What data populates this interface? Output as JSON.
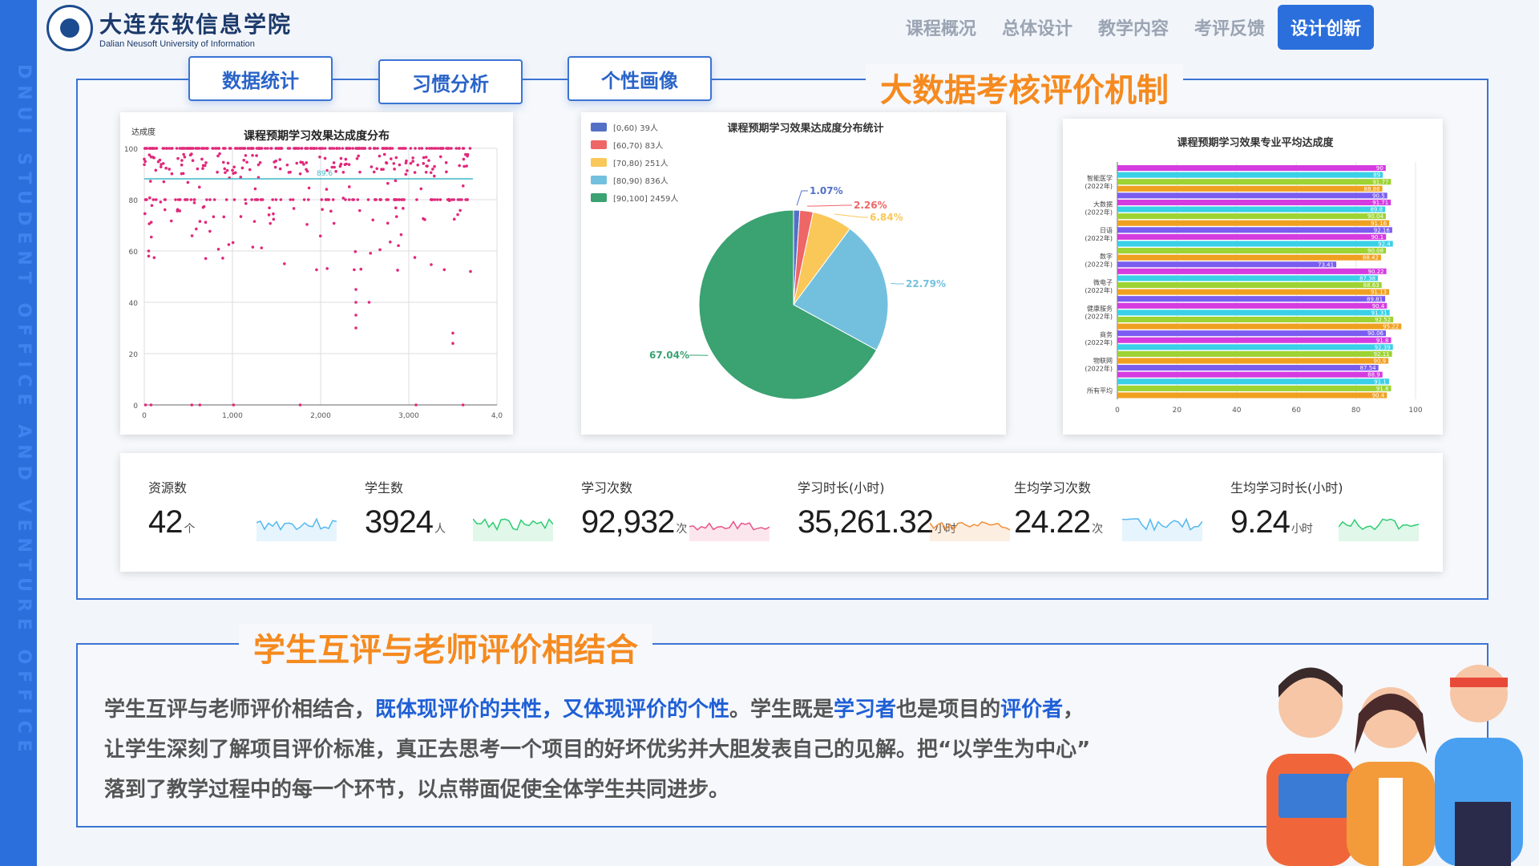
{
  "brand": {
    "cn": "大连东软信息学院",
    "en": "Dalian Neusoft University of Information",
    "side_text": "DNUI STUDENT OFFICE AND VENTURE OFFICE"
  },
  "nav": {
    "items": [
      "课程概况",
      "总体设计",
      "教学内容",
      "考评反馈",
      "设计创新"
    ],
    "active": "设计创新"
  },
  "section1": {
    "title": "大数据考核评价机制",
    "tabs": [
      "数据统计",
      "习惯分析",
      "个性画像"
    ]
  },
  "colors": {
    "primary": "#2a6fdc",
    "accent": "#f58a1f",
    "highlight": "#1f5fd6"
  },
  "chart_data": [
    {
      "type": "scatter",
      "title": "课程预期学习效果达成度分布",
      "ylabel": "达成度",
      "xlim": [
        0,
        4000
      ],
      "ylim": [
        0,
        100
      ],
      "x_ticks": [
        "0",
        "1,000",
        "2,000",
        "3,000",
        "4,0"
      ],
      "y_ticks": [
        "0",
        "20",
        "40",
        "60",
        "80",
        "100"
      ],
      "reference_line": {
        "label": "89.6",
        "value": 90
      },
      "series_color": "#e0287a",
      "grid": true
    },
    {
      "type": "pie",
      "title": "课程预期学习效果达成度分布统计",
      "legend_position": "top-left",
      "legend": [
        "[0,60) 39人",
        "[60,70) 83人",
        "[70,80) 251人",
        "[80,90) 836人",
        "[90,100] 2459人"
      ],
      "slices": [
        {
          "label": "[0,60)",
          "count": 39,
          "percent_label": "1.07%",
          "color": "#5470c6"
        },
        {
          "label": "[60,70)",
          "count": 83,
          "percent_label": "2.26%",
          "color": "#ee6666"
        },
        {
          "label": "[70,80)",
          "count": 251,
          "percent_label": "6.84%",
          "color": "#fac858"
        },
        {
          "label": "[80,90)",
          "count": 836,
          "percent_label": "22.79%",
          "color": "#73c0de"
        },
        {
          "label": "[90,100]",
          "count": 2459,
          "percent_label": "67.04%",
          "color": "#3ba272"
        }
      ]
    },
    {
      "type": "bar",
      "orientation": "horizontal",
      "title": "课程预期学习效果专业平均达成度",
      "xlim": [
        0,
        100
      ],
      "x_ticks": [
        "0",
        "20",
        "40",
        "60",
        "80",
        "100"
      ],
      "categories": [
        "智能医学\n(2022年)",
        "大数据\n(2022年)",
        "日语\n(2022年)",
        "数字\n(2022年)",
        "微电子\n(2022年)",
        "健康服务\n(2022年)",
        "商务\n(2022年)",
        "物联网\n(2022年)",
        "所有平均"
      ],
      "bar_colors": [
        "#d43ce0",
        "#3ad0e8",
        "#9dd332",
        "#f0a020",
        "#7b5cf0"
      ],
      "values": [
        90,
        89,
        91.77,
        88.86,
        90.5,
        91.71,
        89.8,
        90.04,
        91.16,
        92.16,
        90.1,
        92.4,
        90.08,
        88.42,
        73.41,
        90.22,
        87.38,
        88.63,
        91.13,
        89.81,
        90.4,
        91.31,
        92.52,
        95.22,
        90.06,
        91.8,
        92.39,
        92.11,
        90.9,
        87.54,
        88.9,
        91.1,
        91.8,
        90.4
      ],
      "value_labels": [
        "90",
        "89",
        "91.77",
        "88.86",
        "90.5",
        "91.71",
        "89.8",
        "90.04",
        "91.16",
        "92.16",
        "90.1",
        "92.4",
        "90.08",
        "88.42",
        "73.41",
        "90.22",
        "87.38",
        "88.63",
        "91.13",
        "89.81",
        "90.4",
        "91.31",
        "92.52",
        "95.22",
        "90.06",
        "91.8",
        "92.39",
        "92.11",
        "90.9",
        "87.54",
        "88.9",
        "91.1",
        "91.8",
        "90.4"
      ]
    }
  ],
  "stats": [
    {
      "label": "资源数",
      "value": "42",
      "unit": "个",
      "color": "#55b8f0"
    },
    {
      "label": "学生数",
      "value": "3924",
      "unit": "人",
      "color": "#2ecc71"
    },
    {
      "label": "学习次数",
      "value": "92,932",
      "unit": "次",
      "color": "#e8548a"
    },
    {
      "label": "学习时长(小时)",
      "value": "35,261.32",
      "unit": "小时",
      "color": "#f0903a"
    },
    {
      "label": "生均学习次数",
      "value": "24.22",
      "unit": "次",
      "color": "#55b8f0"
    },
    {
      "label": "生均学习时长(小时)",
      "value": "9.24",
      "unit": "小时",
      "color": "#2ecc71"
    }
  ],
  "section2": {
    "title": "学生互评与老师评价相结合",
    "p1": "学生互评与老师评价相结合，",
    "p1_hl": "既体现评价的共性，又体现评价的个性",
    "p2": "。学生既是",
    "p2_hl": "学习者",
    "p3": "也是项目的",
    "p3_hl": "评价者",
    "p4": "，",
    "line2": "让学生深刻了解项目评价标准，真正去思考一个项目的好坏优劣并大胆发表自己的见解。把“以学生为中心”",
    "line3": "落到了教学过程中的每一个环节，以点带面促使全体学生共同进步。"
  }
}
